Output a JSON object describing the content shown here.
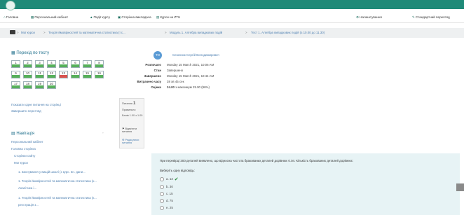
{
  "navbar": {
    "items": [
      {
        "icon": "home-icon",
        "label": "Головна"
      },
      {
        "icon": "dashboard-icon",
        "label": "Персональний кабінет"
      },
      {
        "icon": "events-icon",
        "label": "Події курсу"
      },
      {
        "icon": "courses-icon",
        "label": "Сторінка викладача"
      },
      {
        "icon": "my-courses-icon",
        "label": "Курси на ZTU"
      }
    ],
    "right_items": [
      {
        "icon": "gear-icon",
        "label": "Налаштування"
      },
      {
        "icon": "edit-icon",
        "label": "Стандартний перегляд"
      }
    ]
  },
  "breadcrumb": [
    "Мої курси",
    "Теорія ймовірностей та математична статистика (I с...",
    "Модуль 1. Алгебра випадкових подій",
    "Тест 1. Алгебра випадкових подій (з 10.00 до 11.30)"
  ],
  "quiz_nav": {
    "title": "Перехід по тесту",
    "questions": [
      {
        "n": "1",
        "state": "correct"
      },
      {
        "n": "2",
        "state": "correct"
      },
      {
        "n": "3",
        "state": "correct"
      },
      {
        "n": "4",
        "state": "correct"
      },
      {
        "n": "5",
        "state": "correct"
      },
      {
        "n": "6",
        "state": "correct"
      },
      {
        "n": "7",
        "state": "correct"
      },
      {
        "n": "8",
        "state": "correct"
      },
      {
        "n": "9",
        "state": "correct"
      },
      {
        "n": "10",
        "state": "correct"
      },
      {
        "n": "11",
        "state": "correct"
      },
      {
        "n": "12",
        "state": "correct"
      },
      {
        "n": "13",
        "state": "wrong"
      },
      {
        "n": "14",
        "state": "correct"
      },
      {
        "n": "15",
        "state": "correct"
      },
      {
        "n": "16",
        "state": "correct"
      },
      {
        "n": "17",
        "state": "correct"
      },
      {
        "n": "18",
        "state": "correct"
      },
      {
        "n": "19",
        "state": "correct"
      },
      {
        "n": "20",
        "state": "correct"
      }
    ],
    "links": [
      "Показати одне питання на сторінці",
      "Завершити перегляд"
    ]
  },
  "navigation": {
    "title": "Навігація",
    "items": [
      "Персональний кабінет",
      "Головна сторінка",
      "Сторінки сайту",
      "Мої курси",
      "1. Заснування у вищій школі (з курс. 3н. дани...",
      "1. Теорія ймовірностей та математична статистика (к...",
      "Аналітика і...",
      "1. Теорія ймовірностей та математична статистика (к...",
      "реєстрація з..."
    ]
  },
  "review": {
    "user_name": "Семенюк Сергій Володимирович",
    "avatar_initials": "ТО",
    "rows": [
      {
        "label": "Розпочато",
        "value": "Monday 15 March 2021, 10:06 AM"
      },
      {
        "label": "Стан",
        "value": "Завершено"
      },
      {
        "label": "Завершено",
        "value": "Monday 15 March 2021, 10:44 AM"
      },
      {
        "label": "Витрачено часу",
        "value": "38 хв 45 сек"
      },
      {
        "label": "Оцінка",
        "value_bold": "24.00",
        "value": "з максимум 25.00 (96%)"
      }
    ]
  },
  "question_info": {
    "label": "Питання",
    "number": "1",
    "status": "Правильно",
    "marks": "Балів 1.00 з 1.00",
    "flag": "Відмітити питання",
    "edit": "Редагувати питання"
  },
  "question": {
    "text": "При перевірці 300 деталей виявлено, що відносна частота бракованих деталей дорівнює 0.04. Кількість бракованих деталей дорівнює:",
    "prompt": "Виберіть одну відповідь:",
    "options": [
      {
        "label": "a. 12",
        "correct": true
      },
      {
        "label": "b. 30",
        "correct": false
      },
      {
        "label": "c. 15",
        "correct": false
      },
      {
        "label": "d. 75",
        "correct": false
      },
      {
        "label": "e. 25",
        "correct": false
      }
    ]
  },
  "colors": {
    "header": "#1f8a78",
    "correct": "#56b05a",
    "wrong": "#d9534f",
    "link": "#4b7eb0",
    "question_bg": "#e7f3f5"
  }
}
